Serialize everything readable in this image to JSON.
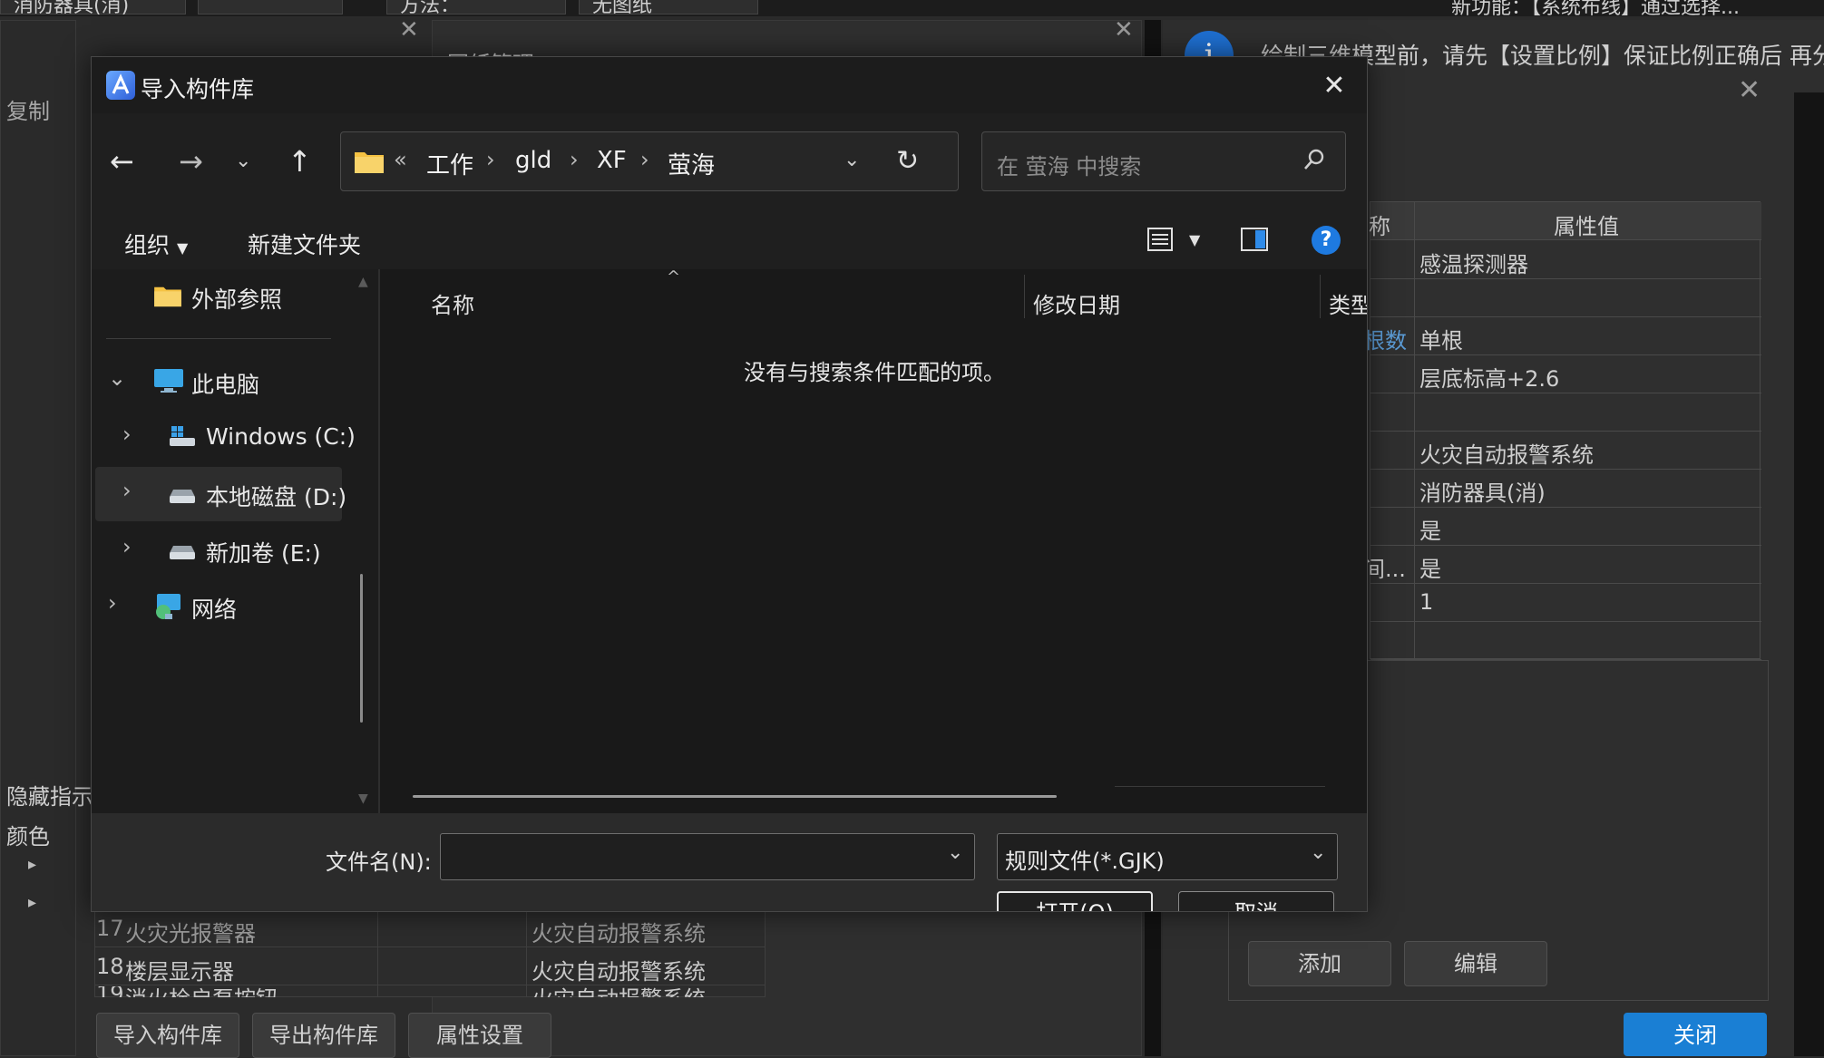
{
  "background_app": {
    "top_tabs": [
      "消防器具(消)",
      "",
      "方法：",
      "无图纸"
    ],
    "left_panel": {
      "copy_label": "复制",
      "hide_label": "隐藏指示",
      "color_label": "颜色"
    },
    "drawing_panel": {
      "title": "图纸管理"
    },
    "notice": {
      "text": "绘制三维模型前，请先【设置比例】保证比例正确后 再分割",
      "top_hint": "新功能：【系统布线】通过选择..."
    },
    "property_table": {
      "header_name": "称",
      "header_value": "属性值",
      "rows": [
        {
          "name": "",
          "value": "感温探测器"
        },
        {
          "name": "",
          "value": ""
        },
        {
          "name": "根数",
          "value": "单根"
        },
        {
          "name": "",
          "value": "层底标高+2.6"
        },
        {
          "name": "",
          "value": ""
        },
        {
          "name": "",
          "value": "火灾自动报警系统"
        },
        {
          "name": "",
          "value": "消防器具(消)"
        },
        {
          "name": "",
          "value": "是"
        },
        {
          "name": "间...",
          "value": "是"
        },
        {
          "name": "",
          "value": "1"
        },
        {
          "name": "",
          "value": ""
        }
      ],
      "add_button": "添加",
      "edit_button": "编辑"
    },
    "component_list": [
      {
        "index": "17",
        "name": "火灾光报警器",
        "system": "火灾自动报警系统"
      },
      {
        "index": "18",
        "name": "楼层显示器",
        "system": "火灾自动报警系统"
      },
      {
        "index": "19",
        "name": "消火栓启泵按钮",
        "system": "火灾自动报警系统"
      }
    ],
    "bottom_buttons": {
      "import": "导入构件库",
      "export": "导出构件库",
      "property_settings": "属性设置",
      "close": "关闭"
    }
  },
  "dialog": {
    "title": "导入构件库",
    "breadcrumb": {
      "overflow": "«",
      "parts": [
        "工作",
        "gld",
        "XF",
        "萤海"
      ],
      "separator": "›"
    },
    "search_placeholder": "在 萤海 中搜索",
    "toolbar": {
      "organize": "组织",
      "new_folder": "新建文件夹"
    },
    "nav": {
      "quick_access": "外部参照",
      "this_pc": "此电脑",
      "drives": [
        "Windows (C:)",
        "本地磁盘 (D:)",
        "新加卷 (E:)"
      ],
      "network": "网络",
      "selected": "本地磁盘 (D:)"
    },
    "columns": {
      "name": "名称",
      "modified": "修改日期",
      "type": "类型"
    },
    "empty_message": "没有与搜索条件匹配的项。",
    "filename_label": "文件名(N):",
    "filename_value": "",
    "filetype_value": "规则文件(*.GJK)",
    "open_button": "打开(O)",
    "cancel_button": "取消"
  },
  "colors": {
    "accent": "#1a7fd4",
    "link": "#5b9bd5",
    "dialog_bg": "#1f1f1f",
    "info_blue": "#1e6fd1"
  }
}
